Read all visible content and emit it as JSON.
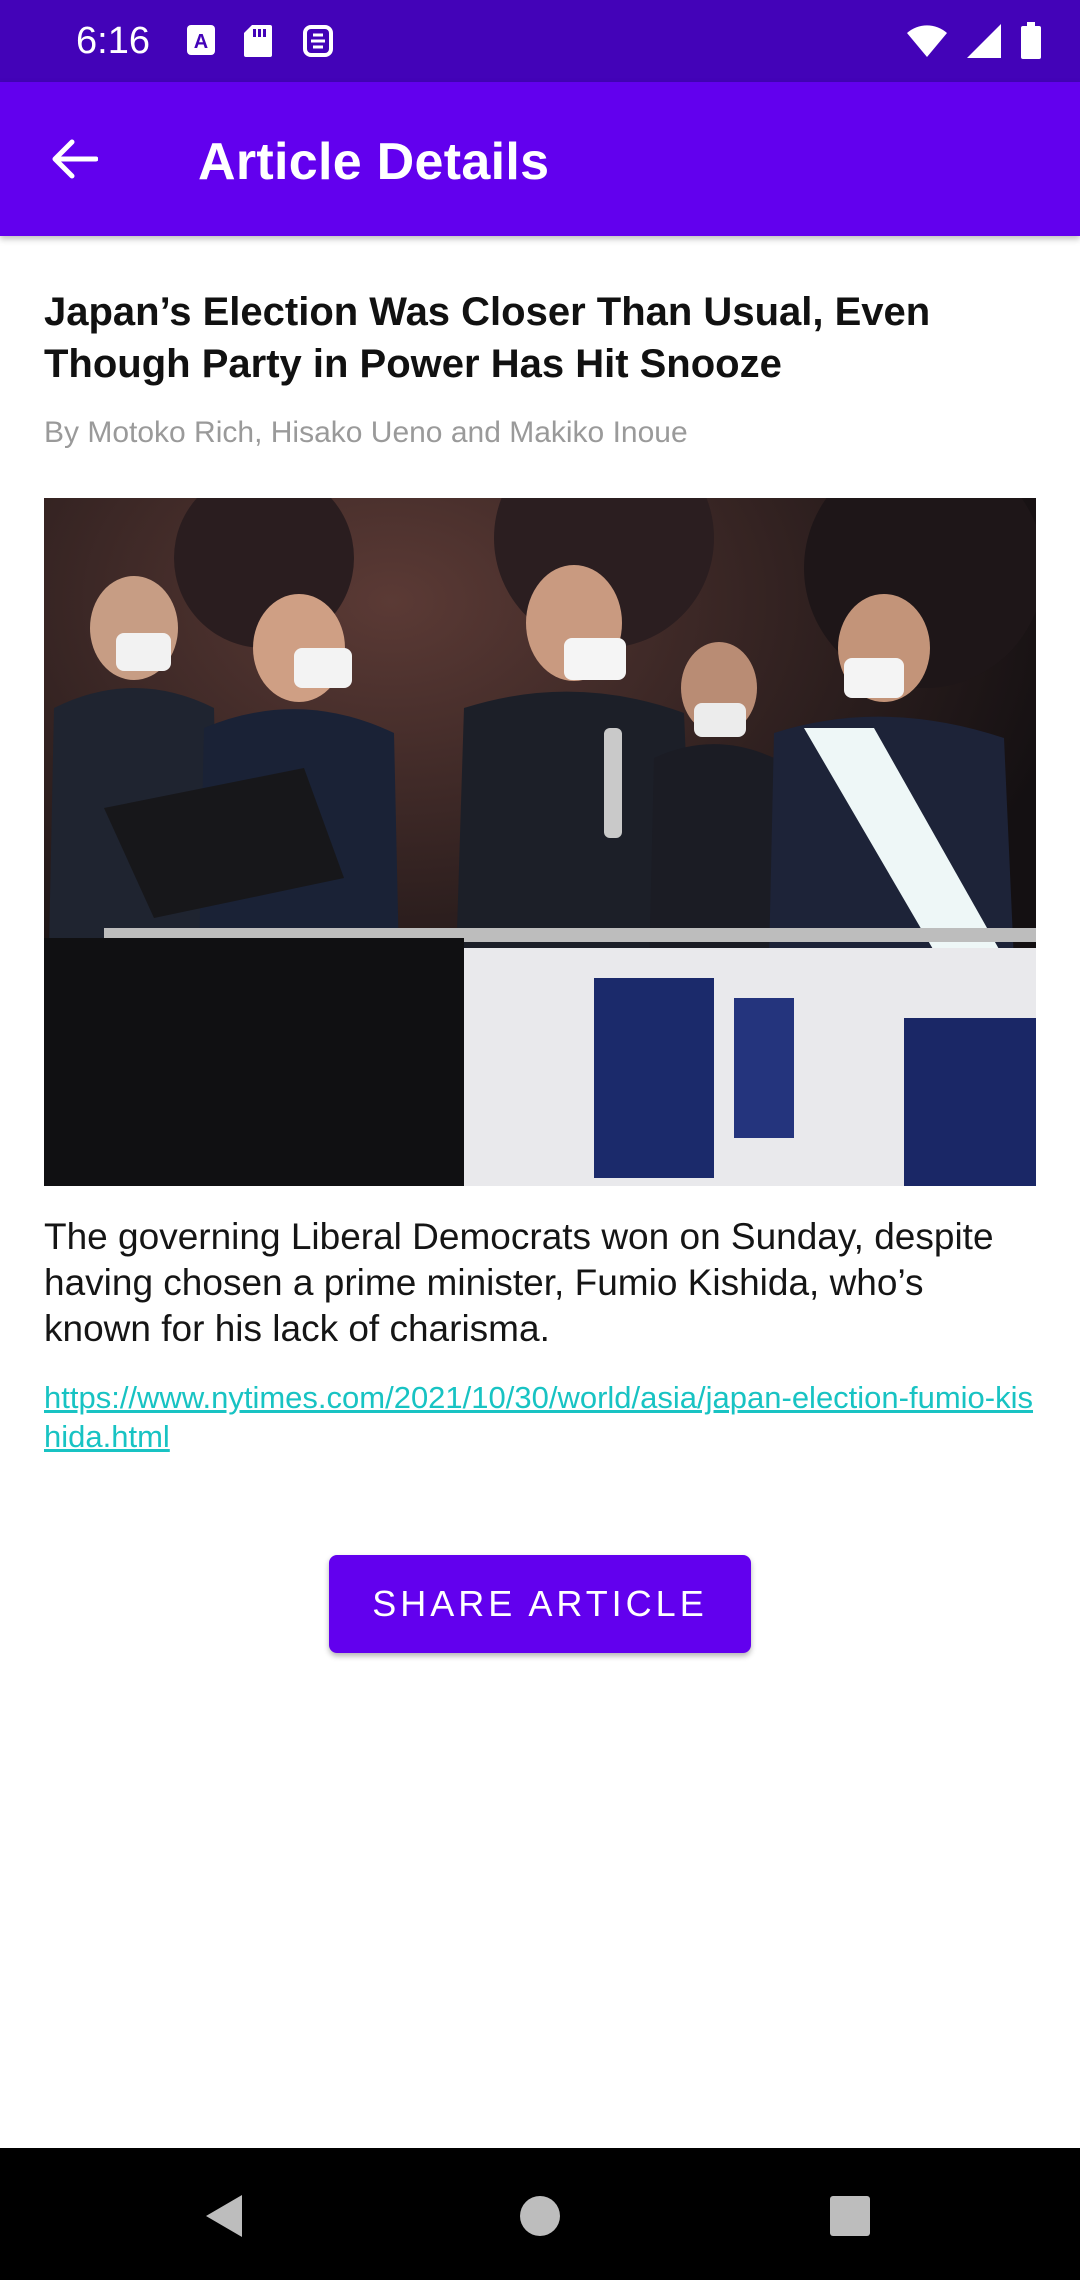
{
  "status_bar": {
    "time": "6:16",
    "left_icons": [
      "keyboard-a-icon",
      "sd-card-icon",
      "sync-icon"
    ],
    "right_icons": [
      "wifi-icon",
      "cell-signal-icon",
      "battery-icon"
    ]
  },
  "app_bar": {
    "title": "Article Details",
    "back_icon": "arrow-back-icon"
  },
  "article": {
    "title": "Japan’s Election Was Closer Than Usual, Even Though Party in Power Has Hit Snooze",
    "byline": "By Motoko Rich, Hisako Ueno and Makiko Inoue",
    "image_alt": "photo",
    "summary": "The governing Liberal Democrats won on Sunday, despite having chosen a prime minister, Fumio Kishida, who’s known for his lack of charisma.",
    "url": "https://www.nytimes.com/2021/10/30/world/asia/japan-election-fumio-kishida.html"
  },
  "share_button": {
    "label": "SHARE ARTICLE"
  },
  "nav_bar": {
    "icons": [
      "nav-back-icon",
      "nav-home-icon",
      "nav-recents-icon"
    ]
  },
  "colors": {
    "status_bar": "#4303b8",
    "app_bar": "#6200ee",
    "accent": "#6200ee",
    "link": "#18c3c3",
    "byline": "#9a9a9a"
  }
}
